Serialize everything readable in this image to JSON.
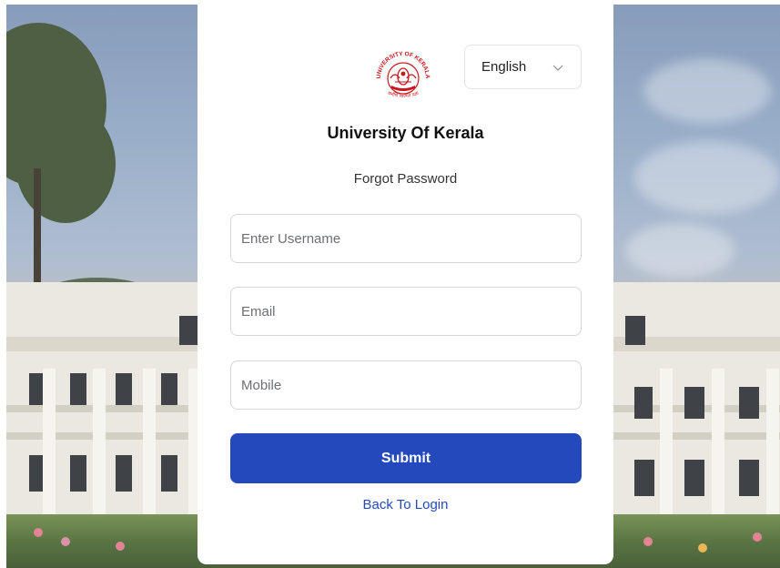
{
  "university": {
    "name": "University Of Kerala",
    "logo_text_top": "UNIVERSITY OF KERALA",
    "logo_text_bottom": "कर्मणि व्यज्यते प्रज्ञा"
  },
  "language_select": {
    "value": "English"
  },
  "page": {
    "subtitle": "Forgot Password"
  },
  "form": {
    "username_placeholder": "Enter Username",
    "email_placeholder": "Email",
    "mobile_placeholder": "Mobile",
    "submit_label": "Submit",
    "back_link": "Back To Login"
  },
  "colors": {
    "primary": "#2349bd",
    "logo_red": "#c8161d"
  },
  "icons": {
    "language_chevron": "chevron-down-icon"
  }
}
